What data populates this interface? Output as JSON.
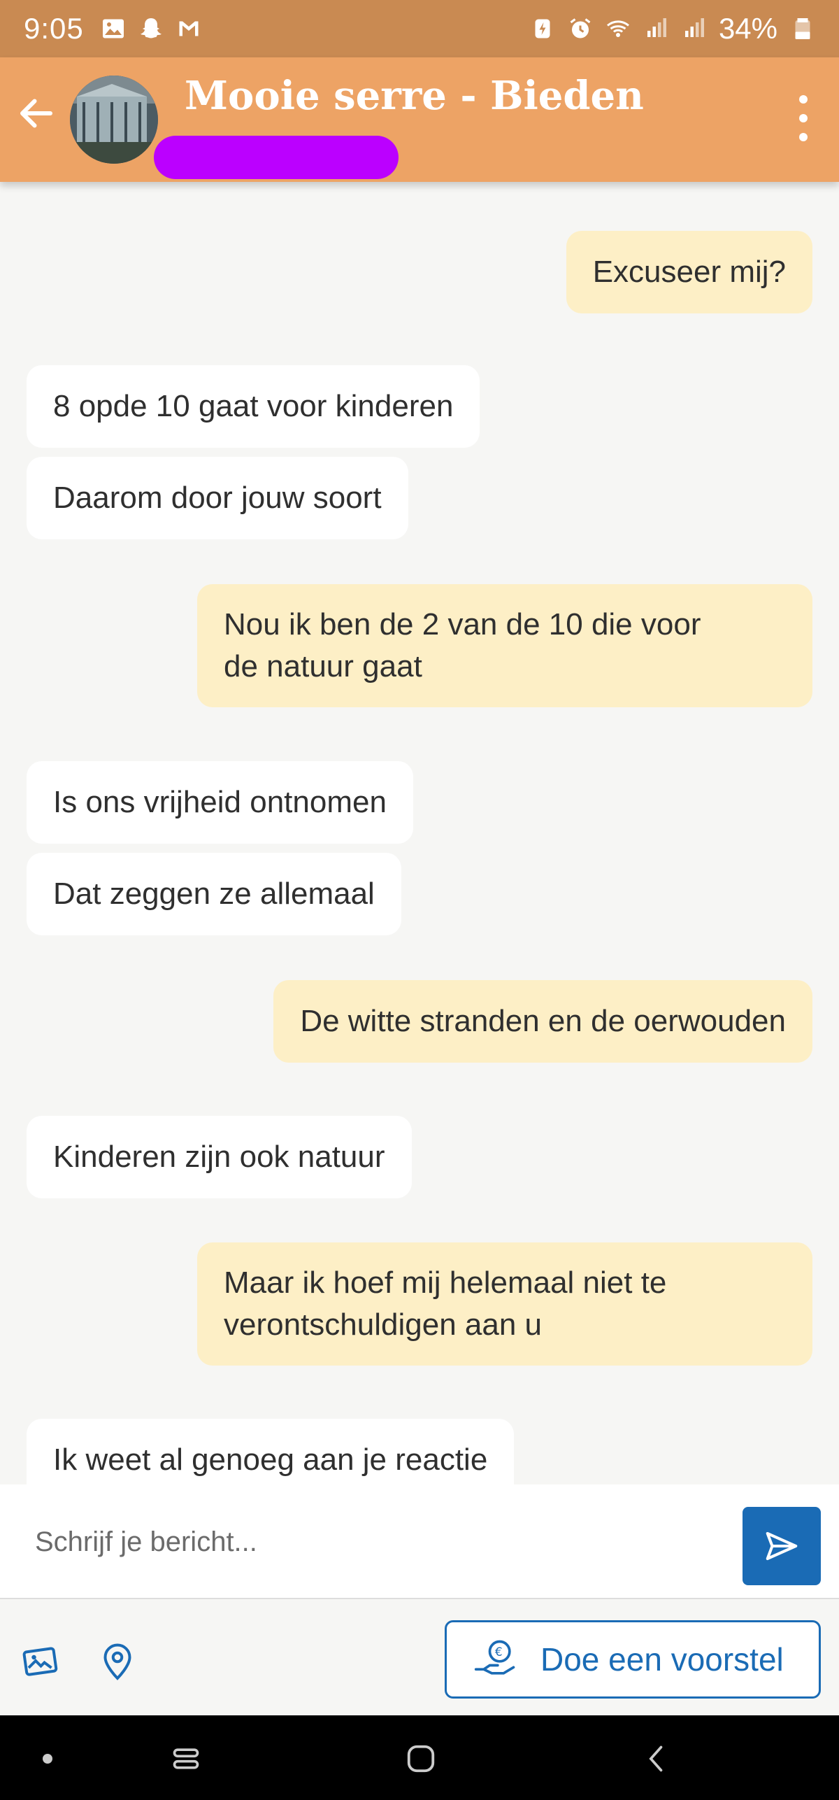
{
  "status_bar": {
    "time": "9:05",
    "battery": "34%"
  },
  "header": {
    "title": "Mooie serre - Bieden"
  },
  "messages": [
    {
      "side": "out",
      "text": "Excuseer mij?"
    },
    {
      "side": "in",
      "text": "8 opde 10 gaat voor kinderen"
    },
    {
      "side": "in",
      "text": "Daarom door jouw soort"
    },
    {
      "side": "out",
      "line1": "Nou ik ben de 2 van de 10 die voor",
      "line2": "de natuur gaat"
    },
    {
      "side": "in",
      "text": "Is ons vrijheid ontnomen"
    },
    {
      "side": "in",
      "text": "Dat zeggen ze allemaal"
    },
    {
      "side": "out",
      "text": "De witte stranden en de oerwouden"
    },
    {
      "side": "in",
      "text": "Kinderen zijn ook natuur"
    },
    {
      "side": "out",
      "line1": "Maar ik hoef mij helemaal niet te",
      "line2": "verontschuldigen aan u"
    },
    {
      "side": "in",
      "text": "Ik weet al genoeg aan je reactie"
    }
  ],
  "composer": {
    "placeholder": "Schrijf je bericht..."
  },
  "actions": {
    "offer_label": "Doe een voorstel"
  },
  "colors": {
    "status_bar": "#c98a52",
    "header": "#eda365",
    "out_bubble": "#fdefc6",
    "in_bubble": "#ffffff",
    "accent": "#1a6bb5",
    "redaction": "#bb00ff"
  }
}
